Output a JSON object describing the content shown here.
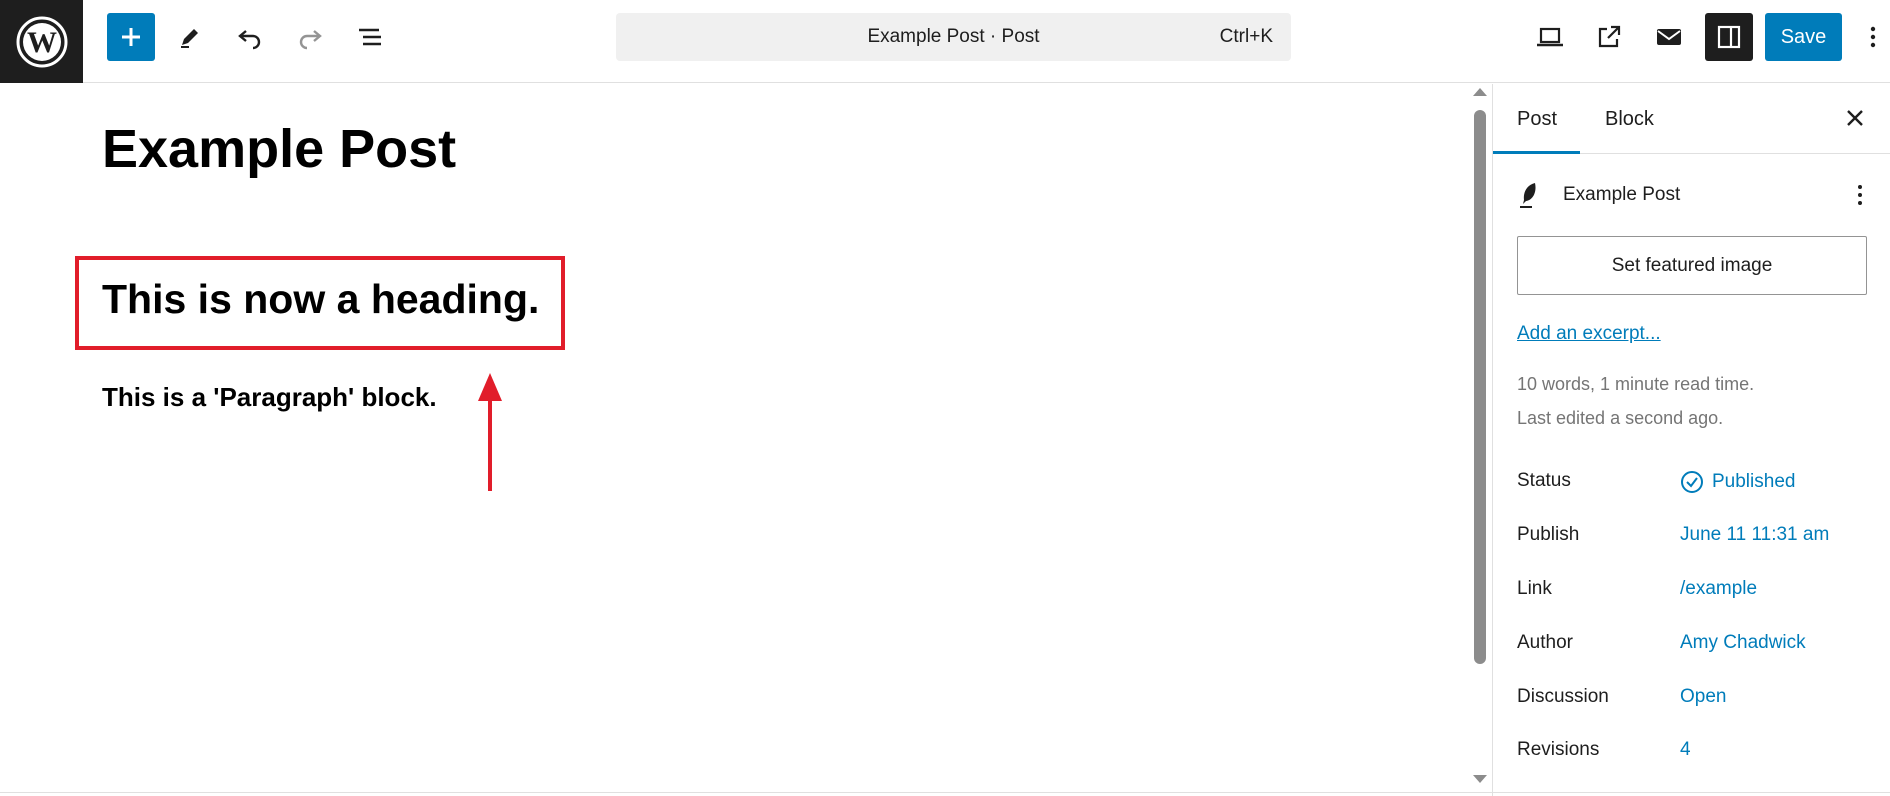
{
  "topbar": {
    "command_title": "Example Post · Post",
    "command_shortcut": "Ctrl+K",
    "save_label": "Save"
  },
  "editor": {
    "post_title": "Example Post",
    "heading_block": "This is now a heading.",
    "paragraph_block": "This is a 'Paragraph' block."
  },
  "sidebar": {
    "tabs": [
      {
        "label": "Post"
      },
      {
        "label": "Block"
      }
    ],
    "post_name": "Example Post",
    "featured_image_label": "Set featured image",
    "excerpt_link": "Add an excerpt...",
    "word_stats": "10 words, 1 minute read time.",
    "last_edited": "Last edited a second ago.",
    "fields": [
      {
        "label": "Status",
        "value": "Published"
      },
      {
        "label": "Publish",
        "value": "June 11 11:31 am"
      },
      {
        "label": "Link",
        "value": "/example"
      },
      {
        "label": "Author",
        "value": "Amy Chadwick"
      },
      {
        "label": "Discussion",
        "value": "Open"
      },
      {
        "label": "Revisions",
        "value": "4"
      }
    ]
  },
  "colors": {
    "accent": "#007cba",
    "annotation": "#e11d2a",
    "dark": "#1e1e1e"
  },
  "icons": [
    "wordpress-logo-icon",
    "plus-icon",
    "pencil-icon",
    "undo-icon",
    "redo-icon",
    "list-view-icon",
    "laptop-preview-icon",
    "external-link-icon",
    "mail-icon",
    "sidebar-toggle-icon",
    "more-vertical-icon",
    "close-icon",
    "feather-icon",
    "check-circle-icon"
  ]
}
